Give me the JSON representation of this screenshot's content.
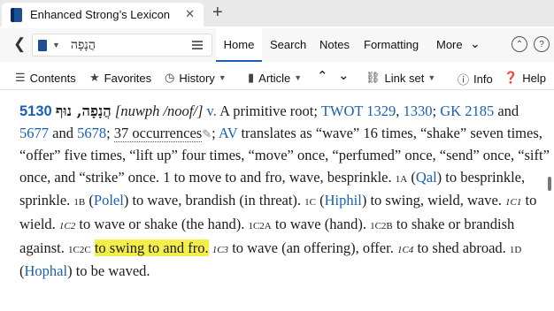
{
  "window": {
    "tab_title": "Enhanced Strong’s Lexicon",
    "close_glyph": "✕",
    "newtab_glyph": "+"
  },
  "nav": {
    "back_glyph": "❮",
    "reference": "הֲנָפָה",
    "menu": [
      "Home",
      "Search",
      "Notes",
      "Formatting",
      "More"
    ],
    "more_chev": "⌄",
    "up_glyph": "⌃",
    "help_glyph": "?"
  },
  "toolbar": {
    "contents": "Contents",
    "favorites": "Favorites",
    "history": "History",
    "article": "Article",
    "link_set": "Link set",
    "info": "Info",
    "help": "Help"
  },
  "entry": {
    "number": "5130",
    "hebrew": "הֲנָפָה, נוּף",
    "translit": "[nuwph /noof/]",
    "pos": "v.",
    "gloss": "A primitive root;",
    "twot_label": "TWOT",
    "twot1": "1329",
    "twot2": "1330",
    "gk_label": "GK",
    "gk": "2185",
    "and1": "and",
    "ref1": "5677",
    "and2": "and",
    "ref2": "5678",
    "occ": "37 occurrences",
    "av": "AV",
    "av_text": "translates as “wave” 16 times, “shake” seven times, “offer” five times, “lift up” four times, “move” once, “perfumed” once, “send” once, “sift” once, and “strike” once.",
    "def1": "1 to move to and fro, wave, besprinkle.",
    "s1a": "1A",
    "qal": "Qal",
    "def1a": "to besprinkle, sprinkle.",
    "s1b": "1B",
    "polel": "Polel",
    "def1b": "to wave, brandish (in threat).",
    "s1c": "1C",
    "hiphil": "Hiphil",
    "def1c": "to swing, wield, wave.",
    "s1c1": "1C1",
    "def1c1": "to wield.",
    "s1c2": "1C2",
    "def1c2": "to wave or shake (the hand).",
    "s1c2a": "1C2A",
    "def1c2a": "to wave (hand).",
    "s1c2b": "1C2B",
    "def1c2b": "to shake or brandish against.",
    "s1c2c": "1C2C",
    "def1c2c": "to swing to and fro.",
    "s1c3": "1C3",
    "def1c3": "to wave (an offering), offer.",
    "s1c4": "1C4",
    "def1c4": "to shed abroad.",
    "s1d": "1D",
    "hophal": "Hophal",
    "def1d": "to be waved."
  }
}
